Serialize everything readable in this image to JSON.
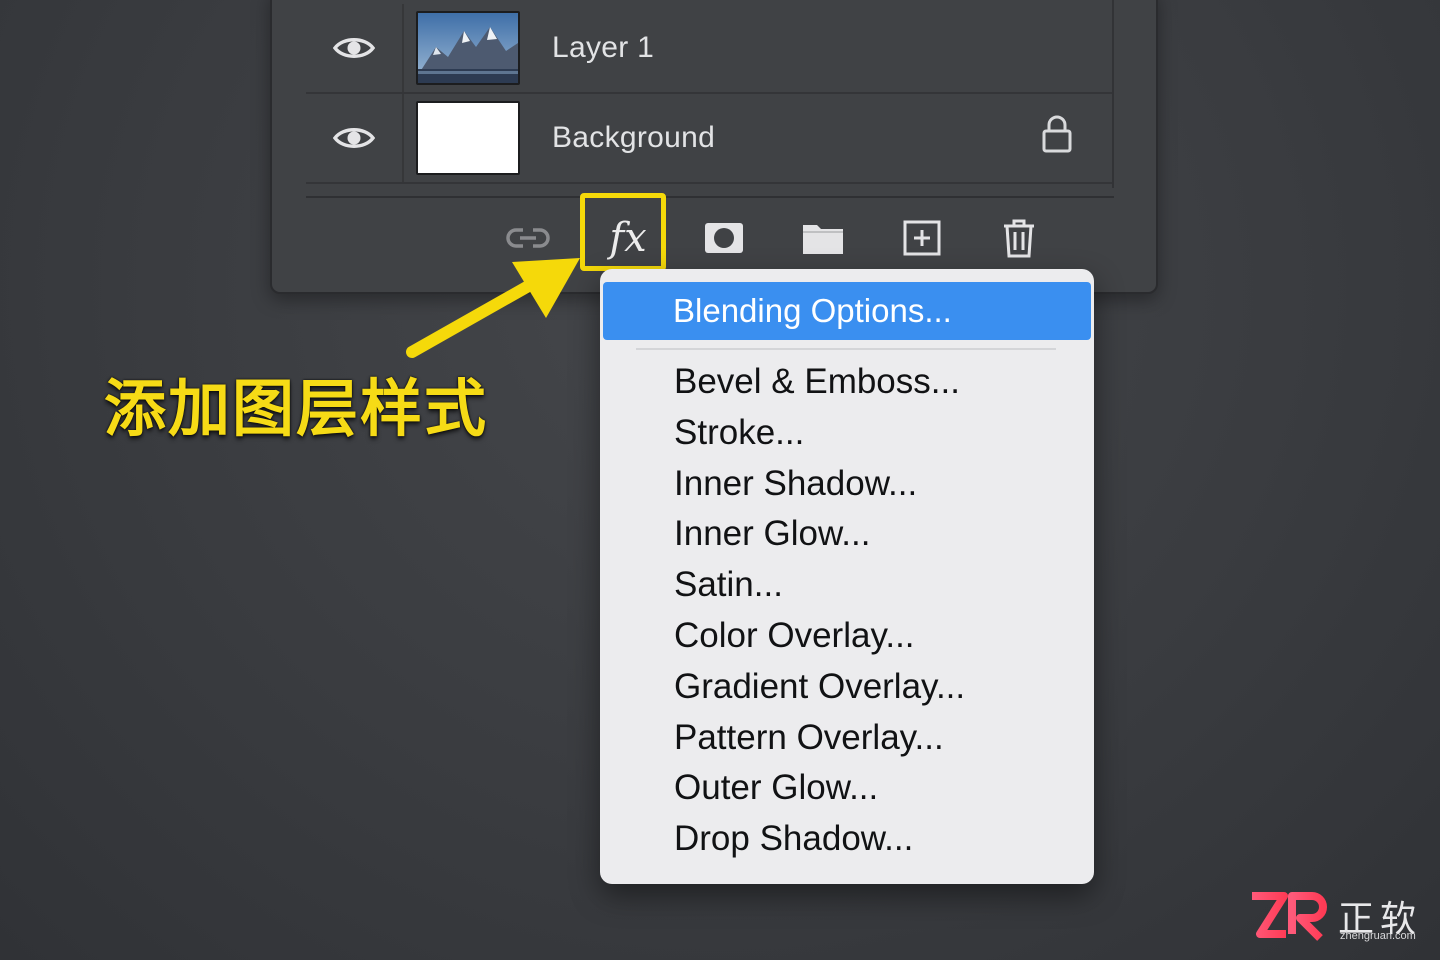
{
  "layers": [
    {
      "name": "Layer 1",
      "thumbnail": "mountain-photo",
      "visible": true,
      "locked": false
    },
    {
      "name": "Background",
      "thumbnail": "white",
      "visible": true,
      "locked": true
    }
  ],
  "toolbar": {
    "fx_label": "fx",
    "icons": [
      "link-icon",
      "fx-icon",
      "mask-icon",
      "folder-icon",
      "new-layer-icon",
      "trash-icon"
    ]
  },
  "menu": {
    "highlighted": "Blending Options...",
    "items": [
      "Bevel & Emboss...",
      "Stroke...",
      "Inner Shadow...",
      "Inner Glow...",
      "Satin...",
      "Color Overlay...",
      "Gradient Overlay...",
      "Pattern Overlay...",
      "Outer Glow...",
      "Drop Shadow..."
    ]
  },
  "annotation": {
    "text": "添加图层样式",
    "color": "#f6db16"
  },
  "watermark": {
    "cn": "正软",
    "url": "zhengruan.com"
  },
  "colors": {
    "highlight": "#3a8ff0",
    "callout": "#f5d90a",
    "background": "#3a3c40"
  }
}
